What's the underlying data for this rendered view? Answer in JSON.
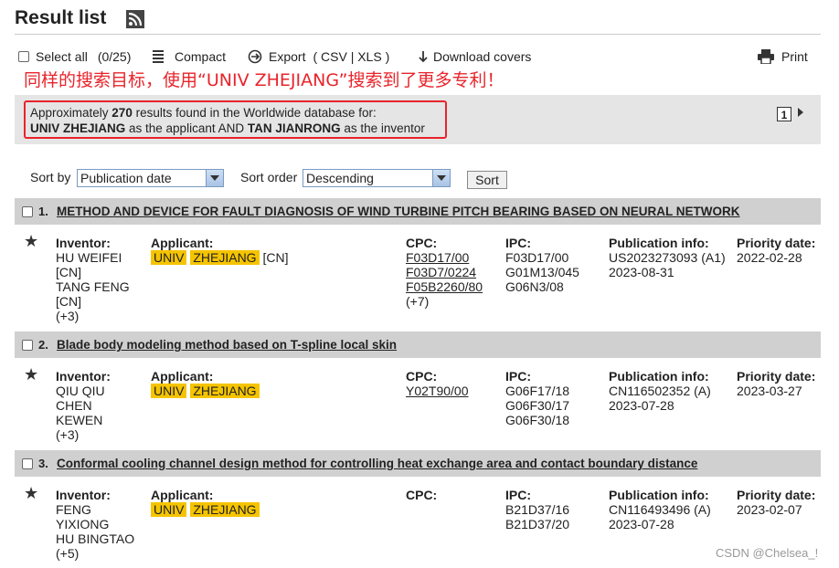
{
  "header": {
    "title": "Result list",
    "rss_icon": "rss-icon"
  },
  "toolbar": {
    "select_all": "Select all",
    "select_count": "(0/25)",
    "compact": "Compact",
    "export": "Export",
    "export_formats": "( CSV | XLS )",
    "download_covers": "Download covers",
    "print": "Print"
  },
  "annotation": "同样的搜索目标，使用“UNIV ZHEJIANG”搜索到了更多专利！",
  "summary": {
    "line1_prefix": "Approximately ",
    "count": "270",
    "line1_suffix": " results found in the Worldwide database for:",
    "applicant": "UNIV ZHEJIANG",
    "mid": " as the applicant AND ",
    "inventor": "TAN JIANRONG",
    "end": " as the inventor",
    "page": "1"
  },
  "sort": {
    "sort_by_label": "Sort by",
    "sort_by_value": "Publication date",
    "sort_order_label": "Sort order",
    "sort_order_value": "Descending",
    "button": "Sort"
  },
  "labels": {
    "inventor": "Inventor:",
    "applicant": "Applicant:",
    "cpc": "CPC:",
    "ipc": "IPC:",
    "priority": "Priority date:",
    "publication": "Publication info:"
  },
  "results": [
    {
      "num": "1.",
      "title": "METHOD AND DEVICE FOR FAULT DIAGNOSIS OF WIND TURBINE PITCH BEARING BASED ON NEURAL NETWORK",
      "inventors": [
        "HU WEIFEI",
        "[CN]",
        "TANG FENG",
        "[CN]",
        "(+3)"
      ],
      "applicant_1": "UNIV",
      "applicant_2": "ZHEJIANG",
      "applicant_cc": "[CN]",
      "cpc": [
        "F03D17/00",
        "F03D7/0224",
        "F05B2260/80"
      ],
      "cpc_more": "(+7)",
      "ipc": [
        "F03D17/00",
        "G01M13/045",
        "G06N3/08"
      ],
      "pub_label": "Publication info:",
      "pub": [
        "US2023273093 (A1)",
        "2023-08-31"
      ],
      "prio_label": "Priority date:",
      "prio": "2022-02-28"
    },
    {
      "num": "2.",
      "title": "Blade body modeling method based on T-spline local skin",
      "inventors": [
        "QIU QIU",
        "CHEN",
        "KEWEN",
        "(+3)"
      ],
      "applicant_1": "UNIV",
      "applicant_2": "ZHEJIANG",
      "cpc": [
        "Y02T90/00"
      ],
      "ipc": [
        "G06F17/18",
        "G06F30/17",
        "G06F30/18"
      ],
      "pub_label": "Publication info:",
      "pub": [
        "CN116502352 (A)",
        "2023-07-28"
      ],
      "prio_label": "Priority date:",
      "prio": "2023-03-27"
    },
    {
      "num": "3.",
      "title": "Conformal cooling channel design method for controlling heat exchange area and contact boundary distance",
      "inventors": [
        "FENG",
        "YIXIONG",
        "HU BINGTAO",
        "(+5)"
      ],
      "applicant_1": "UNIV",
      "applicant_2": "ZHEJIANG",
      "cpc": [],
      "ipc": [
        "B21D37/16",
        "B21D37/20"
      ],
      "pub_label": "Publication info:",
      "pub": [
        "CN116493496 (A)",
        "2023-07-28"
      ],
      "prio_label": "Priority date:",
      "prio": "2023-02-07"
    }
  ],
  "watermark": "CSDN @Chelsea_!"
}
